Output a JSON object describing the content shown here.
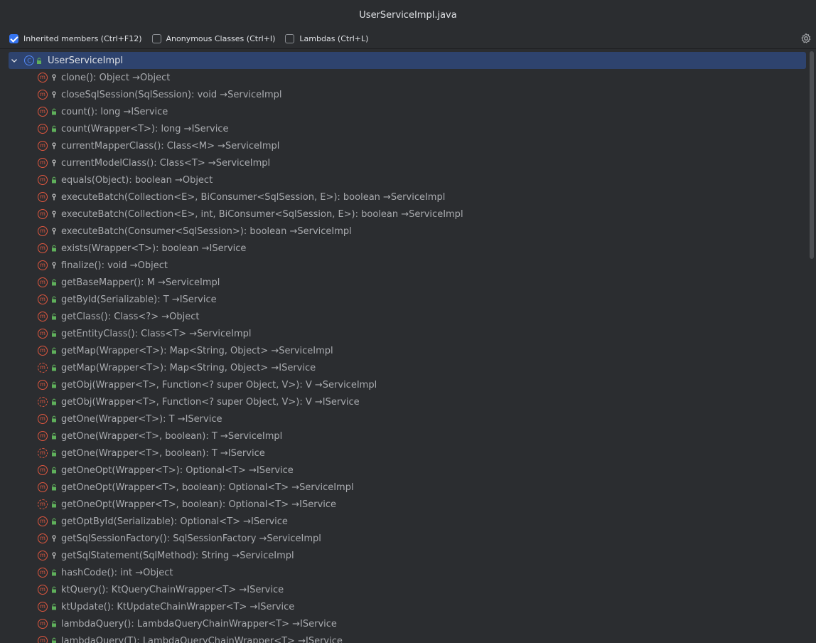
{
  "window": {
    "title": "UserServiceImpl.java"
  },
  "filters": [
    {
      "label": "Inherited members (Ctrl+F12)",
      "checked": true
    },
    {
      "label": "Anonymous Classes (Ctrl+I)",
      "checked": false
    },
    {
      "label": "Lambdas (Ctrl+L)",
      "checked": false
    }
  ],
  "settings_icon": "gear-icon",
  "root": {
    "label": "UserServiceImpl",
    "icon": "class-icon"
  },
  "members": [
    {
      "label": "clone(): Object →Object",
      "visibility": "protected",
      "abstract": false
    },
    {
      "label": "closeSqlSession(SqlSession): void →ServiceImpl",
      "visibility": "protected",
      "abstract": false
    },
    {
      "label": "count(): long →IService",
      "visibility": "public",
      "abstract": false
    },
    {
      "label": "count(Wrapper<T>): long →IService",
      "visibility": "public",
      "abstract": false
    },
    {
      "label": "currentMapperClass(): Class<M> →ServiceImpl",
      "visibility": "protected",
      "abstract": false
    },
    {
      "label": "currentModelClass(): Class<T> →ServiceImpl",
      "visibility": "protected",
      "abstract": false
    },
    {
      "label": "equals(Object): boolean →Object",
      "visibility": "public",
      "abstract": false
    },
    {
      "label": "executeBatch(Collection<E>, BiConsumer<SqlSession, E>): boolean →ServiceImpl",
      "visibility": "protected",
      "abstract": false
    },
    {
      "label": "executeBatch(Collection<E>, int, BiConsumer<SqlSession, E>): boolean →ServiceImpl",
      "visibility": "protected",
      "abstract": false
    },
    {
      "label": "executeBatch(Consumer<SqlSession>): boolean →ServiceImpl",
      "visibility": "protected",
      "abstract": false
    },
    {
      "label": "exists(Wrapper<T>): boolean →IService",
      "visibility": "public",
      "abstract": false
    },
    {
      "label": "finalize(): void →Object",
      "visibility": "protected",
      "abstract": false
    },
    {
      "label": "getBaseMapper(): M →ServiceImpl",
      "visibility": "public",
      "abstract": false
    },
    {
      "label": "getById(Serializable): T →IService",
      "visibility": "public",
      "abstract": false
    },
    {
      "label": "getClass(): Class<?> →Object",
      "visibility": "public",
      "abstract": false
    },
    {
      "label": "getEntityClass(): Class<T> →ServiceImpl",
      "visibility": "public",
      "abstract": false
    },
    {
      "label": "getMap(Wrapper<T>): Map<String, Object> →ServiceImpl",
      "visibility": "public",
      "abstract": false
    },
    {
      "label": "getMap(Wrapper<T>): Map<String, Object> →IService",
      "visibility": "public",
      "abstract": true
    },
    {
      "label": "getObj(Wrapper<T>, Function<? super Object, V>): V →ServiceImpl",
      "visibility": "public",
      "abstract": false
    },
    {
      "label": "getObj(Wrapper<T>, Function<? super Object, V>): V →IService",
      "visibility": "public",
      "abstract": true
    },
    {
      "label": "getOne(Wrapper<T>): T →IService",
      "visibility": "public",
      "abstract": false
    },
    {
      "label": "getOne(Wrapper<T>, boolean): T →ServiceImpl",
      "visibility": "public",
      "abstract": false
    },
    {
      "label": "getOne(Wrapper<T>, boolean): T →IService",
      "visibility": "public",
      "abstract": true
    },
    {
      "label": "getOneOpt(Wrapper<T>): Optional<T> →IService",
      "visibility": "public",
      "abstract": false
    },
    {
      "label": "getOneOpt(Wrapper<T>, boolean): Optional<T> →ServiceImpl",
      "visibility": "public",
      "abstract": false
    },
    {
      "label": "getOneOpt(Wrapper<T>, boolean): Optional<T> →IService",
      "visibility": "public",
      "abstract": true
    },
    {
      "label": "getOptById(Serializable): Optional<T> →IService",
      "visibility": "public",
      "abstract": false
    },
    {
      "label": "getSqlSessionFactory(): SqlSessionFactory →ServiceImpl",
      "visibility": "protected",
      "abstract": false
    },
    {
      "label": "getSqlStatement(SqlMethod): String →ServiceImpl",
      "visibility": "protected",
      "abstract": false
    },
    {
      "label": "hashCode(): int →Object",
      "visibility": "public",
      "abstract": false
    },
    {
      "label": "ktQuery(): KtQueryChainWrapper<T> →IService",
      "visibility": "public",
      "abstract": false
    },
    {
      "label": "ktUpdate(): KtUpdateChainWrapper<T> →IService",
      "visibility": "public",
      "abstract": false
    },
    {
      "label": "lambdaQuery(): LambdaQueryChainWrapper<T> →IService",
      "visibility": "public",
      "abstract": false
    },
    {
      "label": "lambdaQuery(T): LambdaQueryChainWrapper<T> →IService",
      "visibility": "public",
      "abstract": false
    }
  ],
  "colors": {
    "background": "#2b2d30",
    "selection": "#2e436e",
    "method_icon": "#e0573f",
    "class_icon": "#548af7",
    "public_lock": "#5fb05b",
    "protected_key": "#c8c8c8",
    "checkbox_checked": "#3574f0"
  }
}
